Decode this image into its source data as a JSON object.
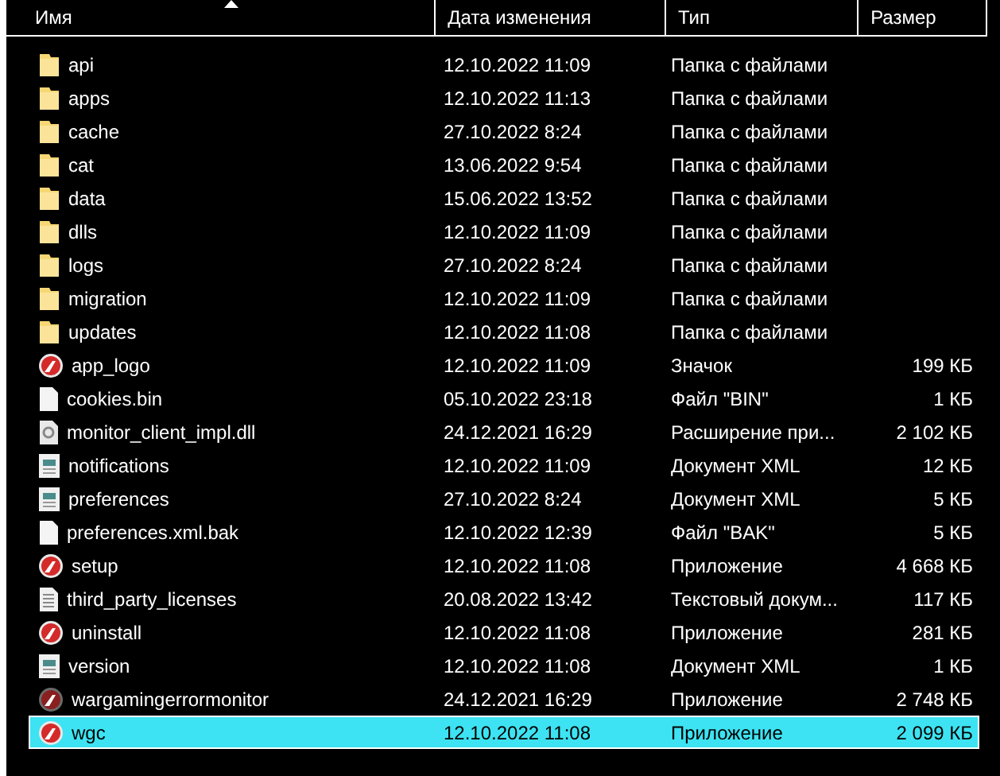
{
  "columns": [
    {
      "label": "Имя",
      "sorted": true
    },
    {
      "label": "Дата изменения",
      "sorted": false
    },
    {
      "label": "Тип",
      "sorted": false
    },
    {
      "label": "Размер",
      "sorted": false
    }
  ],
  "rows": [
    {
      "kind": "folder",
      "name": "api",
      "date": "12.10.2022 11:09",
      "type": "Папка с файлами",
      "selected": false
    },
    {
      "kind": "folder",
      "name": "apps",
      "date": "12.10.2022 11:13",
      "type": "Папка с файлами",
      "selected": false
    },
    {
      "kind": "folder",
      "name": "cache",
      "date": "27.10.2022 8:24",
      "type": "Папка с файлами",
      "selected": false
    },
    {
      "kind": "folder",
      "name": "cat",
      "date": "13.06.2022 9:54",
      "type": "Папка с файлами",
      "selected": false
    },
    {
      "kind": "folder",
      "name": "data",
      "date": "15.06.2022 13:52",
      "type": "Папка с файлами",
      "selected": false
    },
    {
      "kind": "folder",
      "name": "dlls",
      "date": "12.10.2022 11:09",
      "type": "Папка с файлами",
      "selected": false
    },
    {
      "kind": "folder",
      "name": "logs",
      "date": "27.10.2022 8:24",
      "type": "Папка с файлами",
      "selected": false
    },
    {
      "kind": "folder",
      "name": "migration",
      "date": "12.10.2022 11:09",
      "type": "Папка с файлами",
      "selected": false
    },
    {
      "kind": "folder",
      "name": "updates",
      "date": "12.10.2022 11:08",
      "type": "Папка с файлами",
      "selected": false
    },
    {
      "kind": "app",
      "name": "app_logo",
      "date": "12.10.2022 11:09",
      "type": "Значок",
      "size": "199 КБ",
      "selected": false
    },
    {
      "kind": "file",
      "name": "cookies.bin",
      "date": "05.10.2022 23:18",
      "type": "Файл \"BIN\"",
      "size": "1 КБ",
      "selected": false
    },
    {
      "kind": "dll",
      "name": "monitor_client_impl.dll",
      "date": "24.12.2021 16:29",
      "type": "Расширение при...",
      "size": "2 102 КБ",
      "selected": false
    },
    {
      "kind": "xml",
      "name": "notifications",
      "date": "12.10.2022 11:09",
      "type": "Документ XML",
      "size": "12 КБ",
      "selected": false
    },
    {
      "kind": "xml",
      "name": "preferences",
      "date": "27.10.2022 8:24",
      "type": "Документ XML",
      "size": "5 КБ",
      "selected": false
    },
    {
      "kind": "file",
      "name": "preferences.xml.bak",
      "date": "12.10.2022 12:39",
      "type": "Файл \"BAK\"",
      "size": "5 КБ",
      "selected": false
    },
    {
      "kind": "app",
      "name": "setup",
      "date": "12.10.2022 11:08",
      "type": "Приложение",
      "size": "4 668 КБ",
      "selected": false
    },
    {
      "kind": "text",
      "name": "third_party_licenses",
      "date": "20.08.2022 13:42",
      "type": "Текстовый докум...",
      "size": "117 КБ",
      "selected": false
    },
    {
      "kind": "app",
      "name": "uninstall",
      "date": "12.10.2022 11:08",
      "type": "Приложение",
      "size": "281 КБ",
      "selected": false
    },
    {
      "kind": "xml",
      "name": "version",
      "date": "12.10.2022 11:08",
      "type": "Документ XML",
      "size": "1 КБ",
      "selected": false
    },
    {
      "kind": "appdark",
      "name": "wargamingerrormonitor",
      "date": "24.12.2021 16:29",
      "type": "Приложение",
      "size": "2 748 КБ",
      "selected": false
    },
    {
      "kind": "app",
      "name": "wgc",
      "date": "12.10.2022 11:08",
      "type": "Приложение",
      "size": "2 099 КБ",
      "selected": true
    }
  ]
}
